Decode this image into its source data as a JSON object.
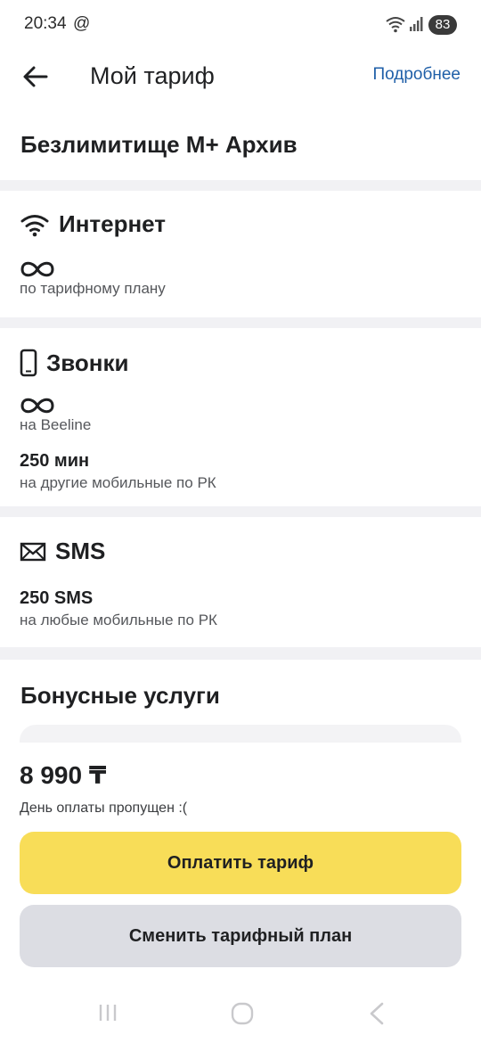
{
  "status_bar": {
    "time": "20:34",
    "at_symbol": "@",
    "battery": "83",
    "icons": [
      "wifi-icon",
      "signal-icon",
      "battery-icon"
    ]
  },
  "header": {
    "title": "Мой тариф",
    "more_link": "Подробнее",
    "back_icon": "arrow-left-icon"
  },
  "plan": {
    "name": "Безлимитище М+ Архив"
  },
  "internet": {
    "title": "Интернет",
    "icon": "wifi-icon",
    "unlimited_label": "по тарифному плану"
  },
  "calls": {
    "title": "Звонки",
    "icon": "phone-icon",
    "unlimited_label": "на Beeline",
    "minutes_value": "250 мин",
    "minutes_label": "на другие мобильные по РК"
  },
  "sms": {
    "title": "SMS",
    "icon": "envelope-icon",
    "value": "250 SMS",
    "label": "на любые мобильные по РК"
  },
  "bonus": {
    "title": "Бонусные услуги"
  },
  "payment": {
    "price": "8 990 ₸",
    "note": "День оплаты пропущен :(",
    "pay_button": "Оплатить тариф",
    "change_button": "Сменить тарифный план"
  },
  "colors": {
    "accent_yellow": "#f8dd58",
    "link_blue": "#1f5fa8",
    "secondary_button": "#dcdde3",
    "separator": "#f1f1f4"
  }
}
